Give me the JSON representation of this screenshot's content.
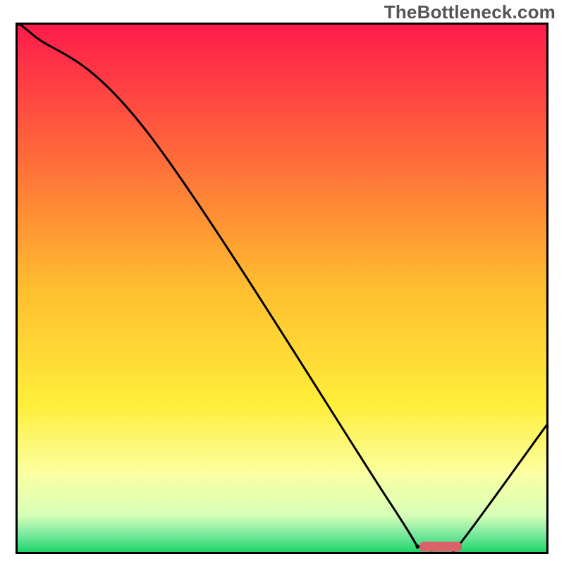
{
  "watermark": "TheBottleneck.com",
  "chart_data": {
    "type": "line",
    "title": "",
    "xlabel": "",
    "ylabel": "",
    "xlim": [
      0,
      100
    ],
    "ylim": [
      0,
      100
    ],
    "grid": false,
    "legend": false,
    "annotations": [],
    "series": [
      {
        "name": "curve",
        "x": [
          0,
          3,
          25,
          70,
          76,
          82,
          84,
          100
        ],
        "values": [
          100,
          98,
          79,
          10,
          1,
          1,
          2,
          24
        ]
      }
    ],
    "marker": {
      "name": "optimal-region",
      "x_start": 76,
      "x_end": 84,
      "y": 1,
      "color": "#d9626b"
    },
    "background_gradient": {
      "stops": [
        {
          "offset": 0.0,
          "color": "#ff1b4b"
        },
        {
          "offset": 0.25,
          "color": "#ff6a3a"
        },
        {
          "offset": 0.5,
          "color": "#ffbe2f"
        },
        {
          "offset": 0.72,
          "color": "#ffee3a"
        },
        {
          "offset": 0.85,
          "color": "#fbffa0"
        },
        {
          "offset": 0.93,
          "color": "#d8ffb8"
        },
        {
          "offset": 0.965,
          "color": "#7fe9a0"
        },
        {
          "offset": 1.0,
          "color": "#1fd56a"
        }
      ]
    },
    "frame_color": "#000000",
    "line_color": "#000000",
    "line_width": 3
  }
}
